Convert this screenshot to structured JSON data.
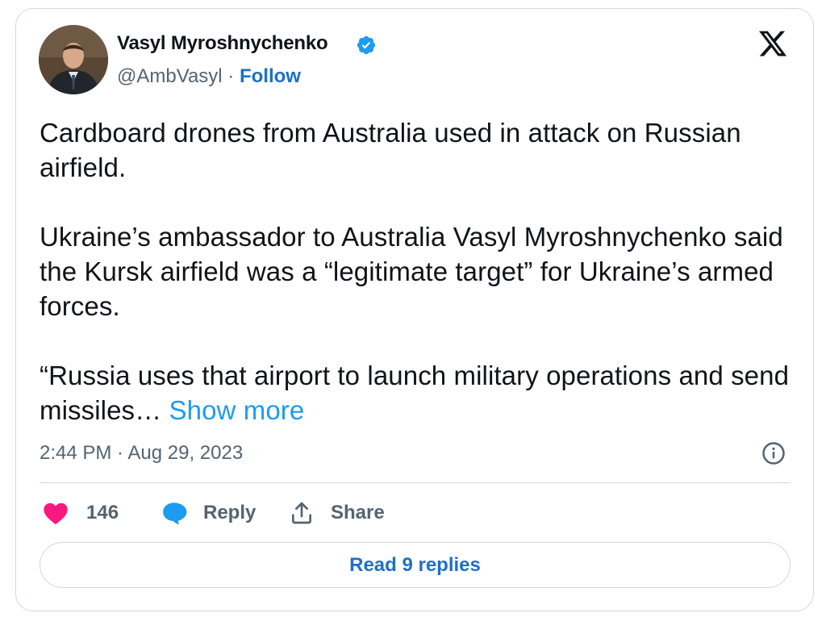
{
  "author": {
    "display_name": "Vasyl Myroshnychenko",
    "handle": "@AmbVasyl",
    "separator": "·",
    "follow_label": "Follow"
  },
  "tweet": {
    "paragraph_1": "Cardboard drones from Australia used in attack on Russian airfield.",
    "paragraph_2": "Ukraine’s ambassador to Australia Vasyl Myroshnychenko said the Kursk airfield was a “legitimate target” for Ukraine’s armed forces.",
    "paragraph_3": "“Russia uses that airport to launch military operations and send missiles…",
    "show_more_label": "Show more"
  },
  "meta": {
    "timestamp": "2:44 PM · Aug 29, 2023"
  },
  "actions": {
    "like_count": "146",
    "reply_label": "Reply",
    "share_label": "Share"
  },
  "read_replies_label": "Read 9 replies",
  "colors": {
    "link": "#1d70c8",
    "show_more": "#1d9bf0",
    "like_heart": "#f91880",
    "reply_bubble": "#1d9bf0",
    "verified": "#1d9bf0",
    "muted": "#536471",
    "border": "#cfd9de"
  },
  "icons": [
    "verified-badge-icon",
    "x-logo-icon",
    "info-icon",
    "heart-icon",
    "reply-bubble-icon",
    "share-icon"
  ]
}
